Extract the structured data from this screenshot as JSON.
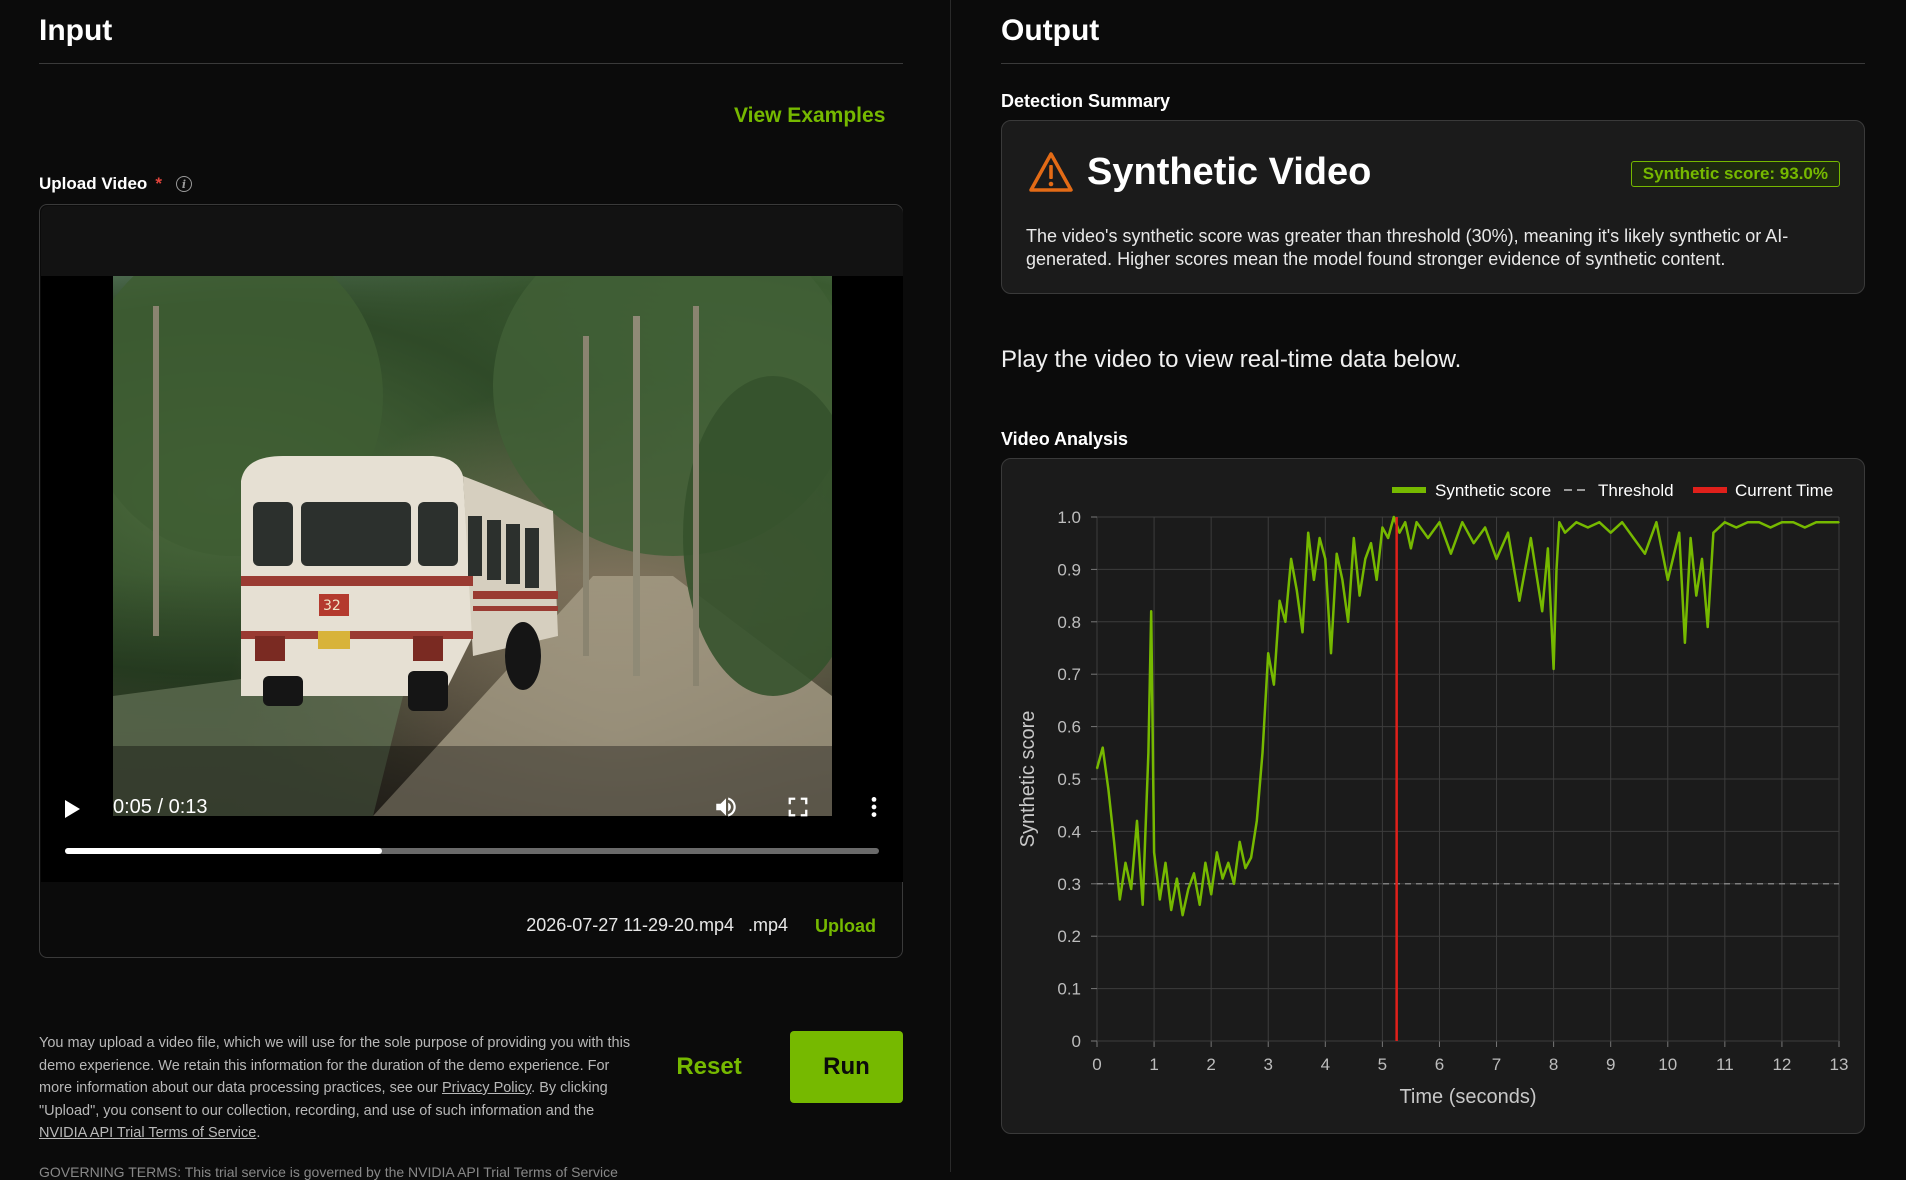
{
  "input": {
    "title": "Input",
    "view_examples": "View Examples",
    "upload_label": "Upload Video",
    "required_mark": "*",
    "info_icon_glyph": "i",
    "video": {
      "time": "0:05 / 0:13",
      "progress": 0.39,
      "bus_plate": "32"
    },
    "file_name": "2026-07-27 11-29-20.mp4",
    "file_ext": ".mp4",
    "upload_button": "Upload",
    "disclaimer_1": "You may upload a video file, which we will use for the sole purpose of providing you with this demo experience. We retain this information for the duration of the demo experience. For more information about our data processing practices, see our ",
    "privacy_link": "Privacy Policy",
    "disclaimer_2": ". By clicking \"Upload\", you consent to our collection, recording, and use of such information and the ",
    "terms_link": "NVIDIA API Trial Terms of Service",
    "disclaimer_3": ".",
    "reset_button": "Reset",
    "run_button": "Run",
    "cut_text": "GOVERNING TERMS: This trial service is governed by the NVIDIA API Trial Terms of Service"
  },
  "output": {
    "title": "Output",
    "summary_label": "Detection Summary",
    "summary_title": "Synthetic Video",
    "score_badge": "Synthetic score: 93.0%",
    "summary_text": "The video's synthetic score was greater than threshold (30%), meaning it's likely synthetic or AI-generated. Higher scores mean the model found stronger evidence of synthetic content.",
    "play_hint": "Play the video to view real-time data below.",
    "analysis_label": "Video Analysis"
  },
  "colors": {
    "accent": "#76b900",
    "threshold": "#9a9a9a",
    "current_time": "#e0201b",
    "warning": "#e36b16"
  },
  "icons": [
    "info-icon",
    "play-icon",
    "volume-icon",
    "fullscreen-icon",
    "more-vert-icon",
    "warning-icon"
  ],
  "chart_data": {
    "type": "line",
    "xlabel": "Time (seconds)",
    "ylabel": "Synthetic score",
    "xlim": [
      0,
      13
    ],
    "ylim": [
      0,
      1
    ],
    "x_ticks": [
      0,
      1,
      2,
      3,
      4,
      5,
      6,
      7,
      8,
      9,
      10,
      11,
      12,
      13
    ],
    "y_ticks": [
      0,
      0.1,
      0.2,
      0.3,
      0.4,
      0.5,
      0.6,
      0.7,
      0.8,
      0.9,
      1.0
    ],
    "y_tick_labels": [
      "0",
      "0.1",
      "0.2",
      "0.3",
      "0.4",
      "0.5",
      "0.6",
      "0.7",
      "0.8",
      "0.9",
      "1.0"
    ],
    "grid": true,
    "legend": "top-right",
    "threshold": 0.3,
    "current_time": 5.25,
    "series": [
      {
        "name": "Synthetic score",
        "x": [
          0,
          0.1,
          0.2,
          0.3,
          0.4,
          0.5,
          0.6,
          0.7,
          0.8,
          0.9,
          0.95,
          1.0,
          1.1,
          1.2,
          1.3,
          1.4,
          1.5,
          1.6,
          1.7,
          1.8,
          1.9,
          2.0,
          2.1,
          2.2,
          2.3,
          2.4,
          2.5,
          2.6,
          2.7,
          2.8,
          2.9,
          3.0,
          3.1,
          3.2,
          3.3,
          3.4,
          3.5,
          3.6,
          3.7,
          3.8,
          3.9,
          4.0,
          4.1,
          4.2,
          4.3,
          4.4,
          4.5,
          4.6,
          4.7,
          4.8,
          4.9,
          5.0,
          5.1,
          5.2,
          5.3,
          5.4,
          5.5,
          5.6,
          5.8,
          6.0,
          6.2,
          6.4,
          6.6,
          6.8,
          7.0,
          7.2,
          7.4,
          7.6,
          7.8,
          7.9,
          8.0,
          8.05,
          8.1,
          8.2,
          8.4,
          8.6,
          8.8,
          9.0,
          9.2,
          9.4,
          9.6,
          9.8,
          10.0,
          10.2,
          10.3,
          10.4,
          10.5,
          10.6,
          10.7,
          10.8,
          11.0,
          11.2,
          11.4,
          11.6,
          11.8,
          12.0,
          12.2,
          12.4,
          12.6,
          12.8,
          13.0
        ],
        "values": [
          0.52,
          0.56,
          0.48,
          0.38,
          0.27,
          0.34,
          0.29,
          0.42,
          0.26,
          0.55,
          0.82,
          0.36,
          0.27,
          0.34,
          0.25,
          0.31,
          0.24,
          0.29,
          0.32,
          0.26,
          0.34,
          0.28,
          0.36,
          0.31,
          0.34,
          0.3,
          0.38,
          0.33,
          0.35,
          0.42,
          0.55,
          0.74,
          0.68,
          0.84,
          0.8,
          0.92,
          0.86,
          0.78,
          0.97,
          0.88,
          0.96,
          0.92,
          0.74,
          0.93,
          0.88,
          0.8,
          0.96,
          0.85,
          0.92,
          0.95,
          0.88,
          0.98,
          0.96,
          1.0,
          0.97,
          0.99,
          0.94,
          0.99,
          0.96,
          0.99,
          0.93,
          0.99,
          0.95,
          0.98,
          0.92,
          0.97,
          0.84,
          0.96,
          0.82,
          0.94,
          0.71,
          0.9,
          0.99,
          0.97,
          0.99,
          0.98,
          0.99,
          0.97,
          0.99,
          0.96,
          0.93,
          0.99,
          0.88,
          0.97,
          0.76,
          0.96,
          0.85,
          0.92,
          0.79,
          0.97,
          0.99,
          0.98,
          0.99,
          0.99,
          0.98,
          0.99,
          0.99,
          0.98,
          0.99,
          0.99,
          0.99
        ]
      },
      {
        "name": "Threshold",
        "values": [
          0.3
        ]
      },
      {
        "name": "Current Time",
        "values": [
          5.25
        ]
      }
    ]
  }
}
